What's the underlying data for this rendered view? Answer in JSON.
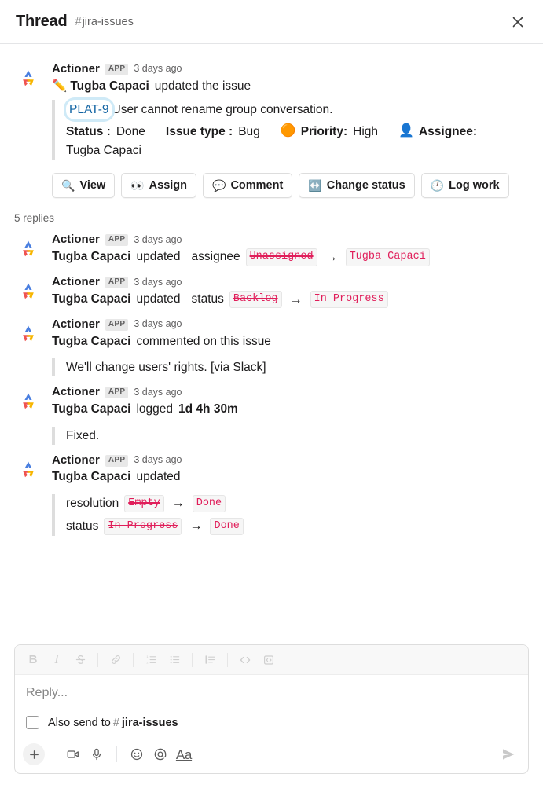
{
  "header": {
    "title": "Thread",
    "hash": "#",
    "channel": "jira-issues",
    "close_icon": "close-icon"
  },
  "root_message": {
    "author": "Actioner",
    "app_badge": "APP",
    "timestamp": "3 days ago",
    "emoji": "✏️",
    "actor": "Tugba Capaci",
    "action_text": "updated the issue",
    "issue": {
      "key": "PLAT-9",
      "summary": "User cannot rename group conversation.",
      "fields": [
        {
          "label": "Status :",
          "value": "Done",
          "emoji": ""
        },
        {
          "label": "Issue type :",
          "value": "Bug",
          "emoji": ""
        },
        {
          "label": "Priority:",
          "value": "High",
          "emoji": "🟠"
        },
        {
          "label": "Assignee:",
          "value": "",
          "emoji": "👤"
        }
      ],
      "assignee_name": "Tugba Capaci"
    },
    "buttons": [
      {
        "icon": "🔍",
        "icon_name": "magnifier-icon",
        "label": "View"
      },
      {
        "icon": "👀",
        "icon_name": "eyes-icon",
        "label": "Assign"
      },
      {
        "icon": "💬",
        "icon_name": "speech-balloon-icon",
        "label": "Comment"
      },
      {
        "icon": "↔️",
        "icon_name": "left-right-arrow-icon",
        "label": "Change status"
      },
      {
        "icon": "🕐",
        "icon_name": "clock-icon",
        "label": "Log work"
      }
    ]
  },
  "replies_divider": {
    "count_label": "5 replies"
  },
  "replies": [
    {
      "type": "field_change",
      "author": "Actioner",
      "app_badge": "APP",
      "timestamp": "3 days ago",
      "actor": "Tugba Capaci",
      "verb": "updated",
      "field": "assignee",
      "old_value": "Unassigned",
      "arrow": "→",
      "new_value": "Tugba Capaci"
    },
    {
      "type": "field_change",
      "author": "Actioner",
      "app_badge": "APP",
      "timestamp": "3 days ago",
      "actor": "Tugba Capaci",
      "verb": "updated",
      "field": "status",
      "old_value": "Backlog",
      "arrow": "→",
      "new_value": "In Progress"
    },
    {
      "type": "comment",
      "author": "Actioner",
      "app_badge": "APP",
      "timestamp": "3 days ago",
      "actor": "Tugba Capaci",
      "verb": "commented on this issue",
      "quote": "We'll change users' rights. [via Slack]"
    },
    {
      "type": "worklog",
      "author": "Actioner",
      "app_badge": "APP",
      "timestamp": "3 days ago",
      "actor": "Tugba Capaci",
      "verb": "logged",
      "duration": "1d 4h 30m",
      "quote": "Fixed."
    },
    {
      "type": "multi_change",
      "author": "Actioner",
      "app_badge": "APP",
      "timestamp": "3 days ago",
      "actor": "Tugba Capaci",
      "verb": "updated",
      "changes": [
        {
          "field": "resolution",
          "old_value": "Empty",
          "arrow": "→",
          "new_value": "Done"
        },
        {
          "field": "status",
          "old_value": "In Progress",
          "arrow": "→",
          "new_value": "Done"
        }
      ]
    }
  ],
  "composer": {
    "format_buttons": [
      {
        "name": "bold-icon",
        "glyph": "B"
      },
      {
        "name": "italic-icon",
        "glyph": "I"
      },
      {
        "name": "strikethrough-icon",
        "glyph": "S"
      },
      {
        "name": "link-icon",
        "glyph": "link"
      },
      {
        "name": "ordered-list-icon",
        "glyph": "ol"
      },
      {
        "name": "bulleted-list-icon",
        "glyph": "ul"
      },
      {
        "name": "blockquote-icon",
        "glyph": "quote"
      },
      {
        "name": "code-icon",
        "glyph": "</>"
      },
      {
        "name": "code-block-icon",
        "glyph": "codeblock"
      }
    ],
    "reply_placeholder": "Reply...",
    "also_send_label": "Also send to",
    "also_send_hash": "#",
    "also_send_channel": "jira-issues",
    "checkbox_checked": false,
    "bottom_buttons": [
      {
        "name": "plus-icon",
        "glyph": "+"
      },
      {
        "name": "video-icon",
        "glyph": "video"
      },
      {
        "name": "microphone-icon",
        "glyph": "mic"
      },
      {
        "name": "emoji-icon",
        "glyph": "smiley"
      },
      {
        "name": "mention-icon",
        "glyph": "@"
      },
      {
        "name": "text-format-icon",
        "glyph": "Aa"
      }
    ],
    "send_icon": "send-icon"
  },
  "colors": {
    "link_blue": "#1264a3",
    "chip_red": "#e01e5a",
    "focus_ring": "#cfeaf7",
    "logo_blue": "#4a7fe0",
    "logo_red": "#ef5350",
    "logo_yellow": "#f7b500"
  }
}
